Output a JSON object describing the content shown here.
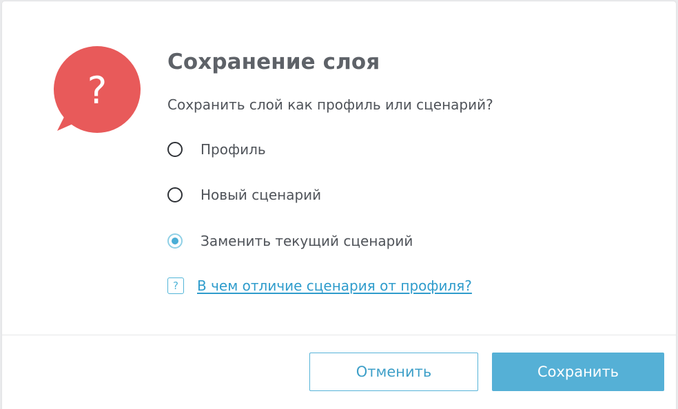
{
  "dialog": {
    "title": "Сохранение слоя",
    "question": "Сохранить слой как профиль или сценарий?",
    "icon": "question-bubble-icon",
    "options": [
      {
        "label": "Профиль",
        "checked": false
      },
      {
        "label": "Новый сценарий",
        "checked": false
      },
      {
        "label": "Заменить текущий сценарий",
        "checked": true
      }
    ],
    "help": {
      "icon_glyph": "?",
      "text": "В чем отличие сценария от профиля?"
    },
    "buttons": {
      "cancel": "Отменить",
      "save": "Сохранить"
    }
  },
  "colors": {
    "icon_red": "#e85a5a",
    "accent": "#55b0d6",
    "link": "#2f9ccc",
    "text": "#4f5359",
    "title": "#5e6268"
  }
}
